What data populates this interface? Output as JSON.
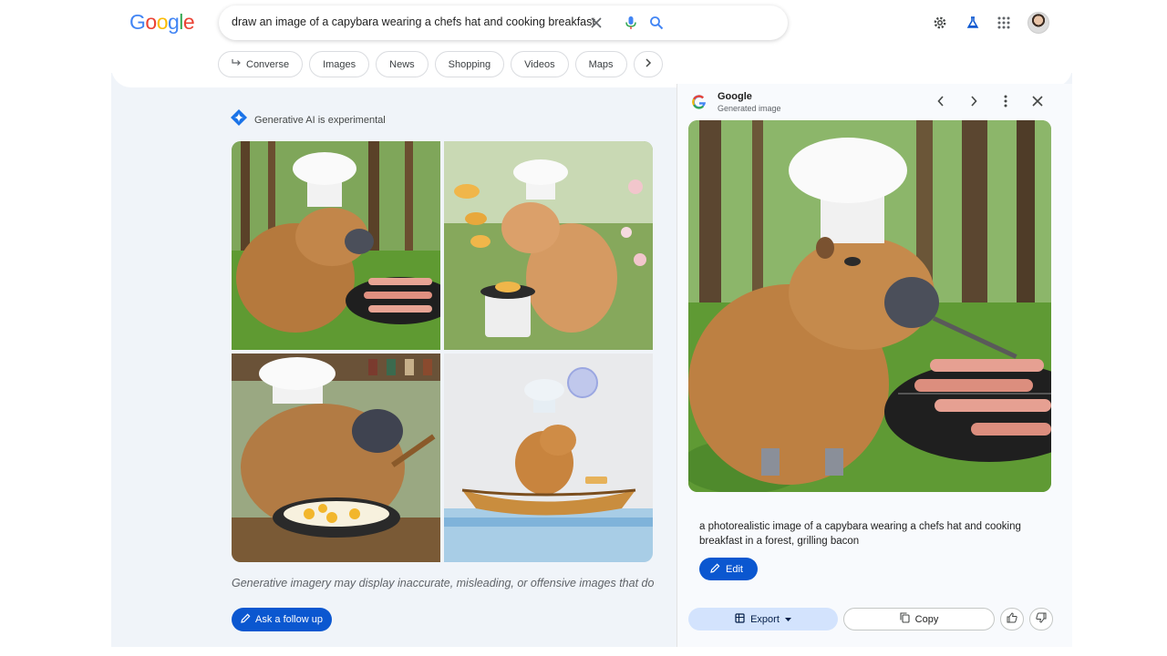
{
  "header": {
    "logo_letters": [
      {
        "ch": "G",
        "color": "#4285F4"
      },
      {
        "ch": "o",
        "color": "#EA4335"
      },
      {
        "ch": "o",
        "color": "#FBBC05"
      },
      {
        "ch": "g",
        "color": "#4285F4"
      },
      {
        "ch": "l",
        "color": "#34A853"
      },
      {
        "ch": "e",
        "color": "#EA4335"
      }
    ],
    "query": "draw an image of a capybara wearing a chefs hat and cooking breakfast",
    "icons": [
      "clear-icon",
      "mic-icon",
      "search-icon",
      "settings-icon",
      "labs-icon",
      "apps-icon"
    ]
  },
  "chips": [
    {
      "label": "Converse",
      "icon": "converse-arrow-icon"
    },
    {
      "label": "Images"
    },
    {
      "label": "News"
    },
    {
      "label": "Shopping"
    },
    {
      "label": "Videos"
    },
    {
      "label": "Maps"
    }
  ],
  "main": {
    "ai_label": "Generative AI is experimental",
    "images": [
      {
        "name": "capybara-grilling-bacon-forest"
      },
      {
        "name": "capybara-flipping-pancakes"
      },
      {
        "name": "capybara-frying-eggs"
      },
      {
        "name": "capybara-in-boat"
      }
    ],
    "disclaimer": "Generative imagery may display inaccurate, misleading, or offensive images that do",
    "follow_up_label": "Ask a follow up"
  },
  "panel": {
    "title": "Google",
    "subtitle": "Generated image",
    "caption": "a photorealistic image of a capybara wearing a chefs hat and cooking breakfast in a forest, grilling bacon",
    "edit_label": "Edit",
    "export_label": "Export",
    "copy_label": "Copy"
  },
  "colors": {
    "accent": "#0b57d0",
    "export_bg": "#d3e3fd",
    "main_bg": "#f0f4f9"
  }
}
